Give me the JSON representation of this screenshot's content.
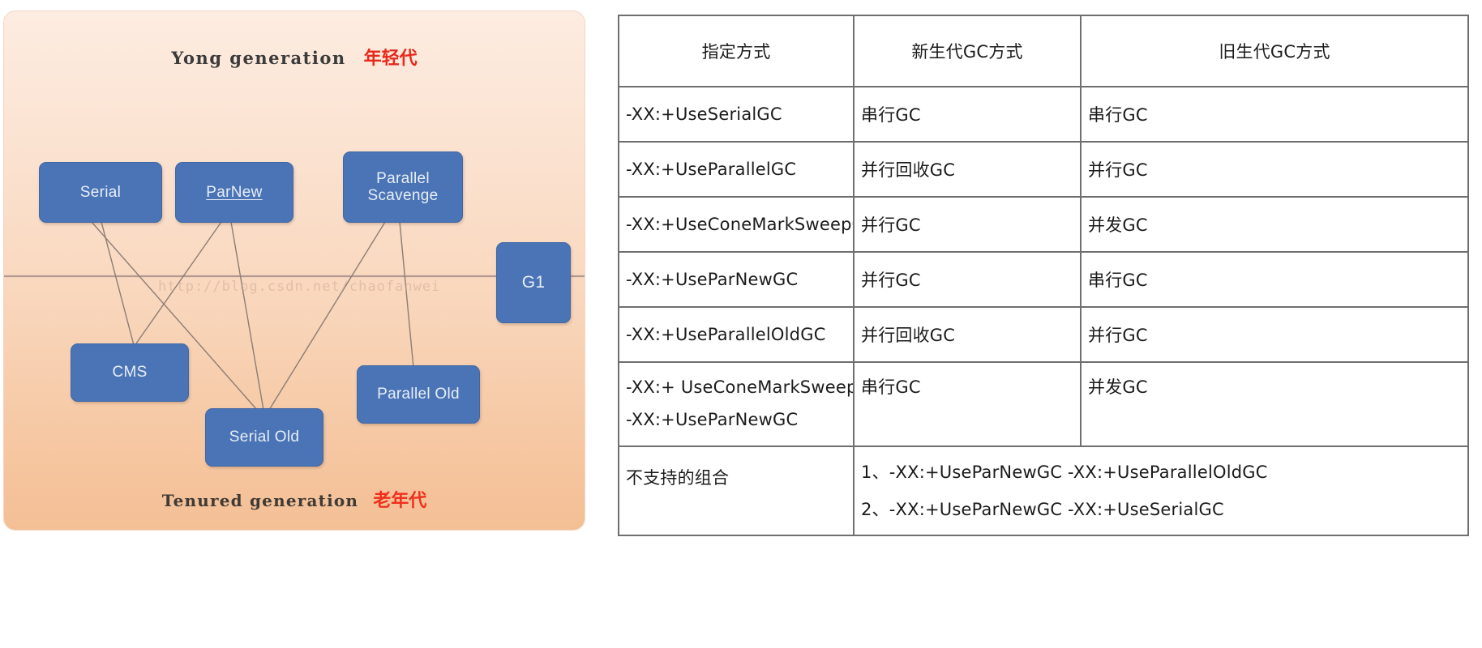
{
  "diagram": {
    "young_generation_label_en": "Yong generation",
    "young_generation_label_cn": "年轻代",
    "tenured_generation_label_en": "Tenured generation",
    "tenured_generation_label_cn": "老年代",
    "watermark": "http://blog.csdn.net/chaofanwei",
    "colors": {
      "node_fill": "#4a74b5",
      "node_text": "#e8eef8",
      "panel_gradient_top": "#fdece1",
      "panel_gradient_bottom": "#f4bf95",
      "accent_red": "#e8281b",
      "divider": "#b3998f",
      "connector": "#8c7d74"
    },
    "nodes": [
      {
        "id": "serial",
        "label": "Serial",
        "label2": "",
        "underlined": false
      },
      {
        "id": "parnew",
        "label": "ParNew",
        "label2": "",
        "underlined": true
      },
      {
        "id": "parallel_scavenge",
        "label": "Parallel",
        "label2": "Scavenge",
        "underlined": false
      },
      {
        "id": "cms",
        "label": "CMS",
        "label2": "",
        "underlined": false
      },
      {
        "id": "serial_old",
        "label": "Serial Old",
        "label2": "",
        "underlined": false
      },
      {
        "id": "parallel_old",
        "label": "Parallel Old",
        "label2": "",
        "underlined": false
      },
      {
        "id": "g1",
        "label": "G1",
        "label2": "",
        "underlined": false
      }
    ],
    "connections": [
      {
        "from": "serial",
        "to": "serial_old"
      },
      {
        "from": "serial",
        "to": "cms"
      },
      {
        "from": "parnew",
        "to": "cms"
      },
      {
        "from": "parnew",
        "to": "serial_old"
      },
      {
        "from": "parallel_scavenge",
        "to": "serial_old"
      },
      {
        "from": "parallel_scavenge",
        "to": "parallel_old"
      }
    ]
  },
  "table": {
    "headers": [
      "指定方式",
      "新生代GC方式",
      "旧生代GC方式"
    ],
    "rows": [
      {
        "option": "-XX:+UseSerialGC",
        "option2": "",
        "young": "串行GC",
        "old": "串行GC"
      },
      {
        "option": "-XX:+UseParallelGC",
        "option2": "",
        "young": "并行回收GC",
        "old": "并行GC"
      },
      {
        "option": "-XX:+UseConeMarkSweepGC",
        "option2": "",
        "young": "并行GC",
        "old": "并发GC"
      },
      {
        "option": "-XX:+UseParNewGC",
        "option2": "",
        "young": "并行GC",
        "old": "串行GC"
      },
      {
        "option": "-XX:+UseParallelOldGC",
        "option2": "",
        "young": "并行回收GC",
        "old": "并行GC"
      },
      {
        "option": "-XX:+ UseConeMarkSweepGC",
        "option2": "-XX:+UseParNewGC",
        "young": "串行GC",
        "old": "并发GC"
      }
    ],
    "unsupported": {
      "label": "不支持的组合",
      "items": [
        "1、-XX:+UseParNewGC -XX:+UseParallelOldGC",
        "2、-XX:+UseParNewGC -XX:+UseSerialGC"
      ]
    }
  }
}
